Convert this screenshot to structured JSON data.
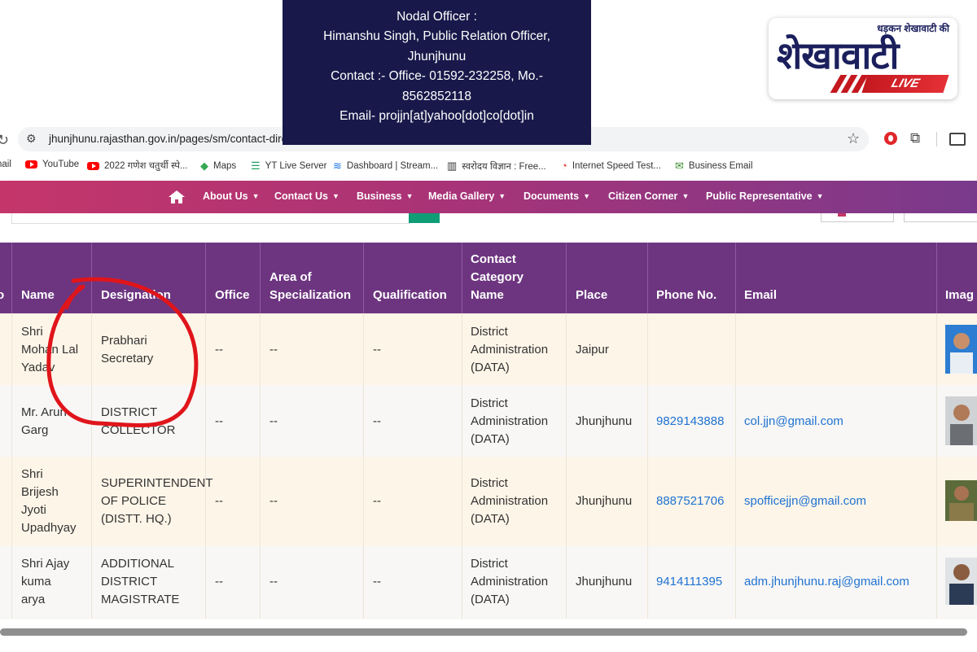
{
  "nodal": {
    "line1": "Nodal Officer :",
    "line2": "Himanshu Singh, Public Relation Officer,",
    "line3": "Jhunjhunu",
    "line4": "Contact :- Office- 01592-232258, Mo.-",
    "line5": "8562852118",
    "line6": "Email- projjn[at]yahoo[dot]co[dot]in"
  },
  "logo": {
    "small": "धड़कन शेखावाटी की",
    "big": "शेखावाटी",
    "live": "LIVE"
  },
  "browser": {
    "url": "jhunjhunu.rajasthan.gov.in/pages/sm/contact-direct",
    "bookmarks": [
      {
        "label": "nail",
        "icon": "gmail-icon"
      },
      {
        "label": "YouTube",
        "icon": "youtube-icon"
      },
      {
        "label": "2022 गणेश चतुर्थी स्पे...",
        "icon": "youtube-icon"
      },
      {
        "label": "Maps",
        "icon": "maps-icon"
      },
      {
        "label": "YT Live Server",
        "icon": "list-icon"
      },
      {
        "label": "Dashboard | Stream...",
        "icon": "stream-icon"
      },
      {
        "label": "स्वरोदय विज्ञान : Free...",
        "icon": "book-icon"
      },
      {
        "label": "Internet Speed Test...",
        "icon": "speedometer-icon"
      },
      {
        "label": "Business Email",
        "icon": "mail-icon"
      }
    ]
  },
  "nav": {
    "items": [
      "About Us",
      "Contact Us",
      "Business",
      "Media Gallery",
      "Documents",
      "Citizen Corner",
      "Public Representative"
    ]
  },
  "table": {
    "headers": [
      "o",
      "Name",
      "Designation",
      "Office",
      "Area of Specialization",
      "Qualification",
      "Contact Category Name",
      "Place",
      "Phone No.",
      "Email",
      "Imag"
    ],
    "rows": [
      {
        "name": [
          "Shri",
          "Mohan Lal",
          "Yadav"
        ],
        "designation": [
          "Prabhari",
          "Secretary"
        ],
        "office": "--",
        "area": "--",
        "qualification": "--",
        "category": [
          "District",
          "Administration",
          "(DATA)"
        ],
        "place": "Jaipur",
        "phone": "",
        "email": ""
      },
      {
        "name": [
          "Mr. Arun",
          "Garg"
        ],
        "designation": [
          "DISTRICT",
          "COLLECTOR"
        ],
        "office": "--",
        "area": "--",
        "qualification": "--",
        "category": [
          "District",
          "Administration",
          "(DATA)"
        ],
        "place": "Jhunjhunu",
        "phone": "9829143888",
        "email": "col.jjn@gmail.com"
      },
      {
        "name": [
          "Shri",
          "Brijesh",
          "Jyoti",
          "Upadhyay"
        ],
        "designation": [
          "SUPERINTENDENT",
          "OF POLICE",
          "(DISTT. HQ.)"
        ],
        "office": "--",
        "area": "--",
        "qualification": "--",
        "category": [
          "District",
          "Administration",
          "(DATA)"
        ],
        "place": "Jhunjhunu",
        "phone": "8887521706",
        "email": "spofficejjn@gmail.com"
      },
      {
        "name": [
          "Shri Ajay",
          "kuma",
          "arya"
        ],
        "designation": [
          "ADDITIONAL",
          "DISTRICT",
          "MAGISTRATE"
        ],
        "office": "--",
        "area": "--",
        "qualification": "--",
        "category": [
          "District",
          "Administration",
          "(DATA)"
        ],
        "place": "Jhunjhunu",
        "phone": "9414111395",
        "email": "adm.jhunjhunu.raj@gmail.com"
      }
    ]
  },
  "colors": {
    "nav_start": "#c4366a",
    "nav_end": "#7a3a8c",
    "table_header": "#6d3580",
    "row_odd": "#fdf5e8",
    "link": "#1f72d1",
    "annotation": "#e0151b"
  }
}
